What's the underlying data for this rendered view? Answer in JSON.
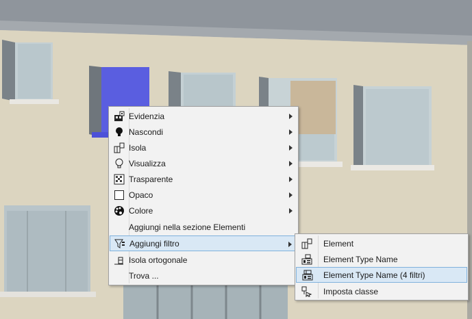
{
  "context_menu": {
    "items": [
      {
        "label": "Evidenzia",
        "icon": "highlight-icon",
        "has_submenu": true
      },
      {
        "label": "Nascondi",
        "icon": "lightbulb-dark-icon",
        "has_submenu": true
      },
      {
        "label": "Isola",
        "icon": "isolate-grid-icon",
        "has_submenu": true
      },
      {
        "label": "Visualizza",
        "icon": "lightbulb-outline-icon",
        "has_submenu": true
      },
      {
        "label": "Trasparente",
        "icon": "transparent-pattern-icon",
        "has_submenu": true
      },
      {
        "label": "Opaco",
        "icon": "opaque-square-icon",
        "has_submenu": true
      },
      {
        "label": "Colore",
        "icon": "palette-icon",
        "has_submenu": true
      },
      {
        "label": "Aggiungi nella sezione Elementi",
        "icon": "",
        "has_submenu": false
      },
      {
        "label": "Aggiungi filtro",
        "icon": "filter-icon",
        "has_submenu": true,
        "highlighted": true
      },
      {
        "label": "Isola ortogonale",
        "icon": "orthogonal-isolate-icon",
        "has_submenu": false
      },
      {
        "label": "Trova ...",
        "icon": "",
        "has_submenu": false
      }
    ]
  },
  "submenu": {
    "items": [
      {
        "label": "Element",
        "icon": "element-grid-icon"
      },
      {
        "label": "Element Type Name",
        "icon": "element-type-icon"
      },
      {
        "label": "Element Type Name (4 filtri)",
        "icon": "element-type-filters-icon",
        "highlighted": true
      },
      {
        "label": "Imposta classe",
        "icon": "set-class-icon"
      }
    ]
  },
  "colors": {
    "facade": "#d9d2bd",
    "selection": "#5a5ee0",
    "menu_bg": "#f2f2f2",
    "highlight": "#d9e8f5",
    "highlight_border": "#7fb1dc"
  }
}
